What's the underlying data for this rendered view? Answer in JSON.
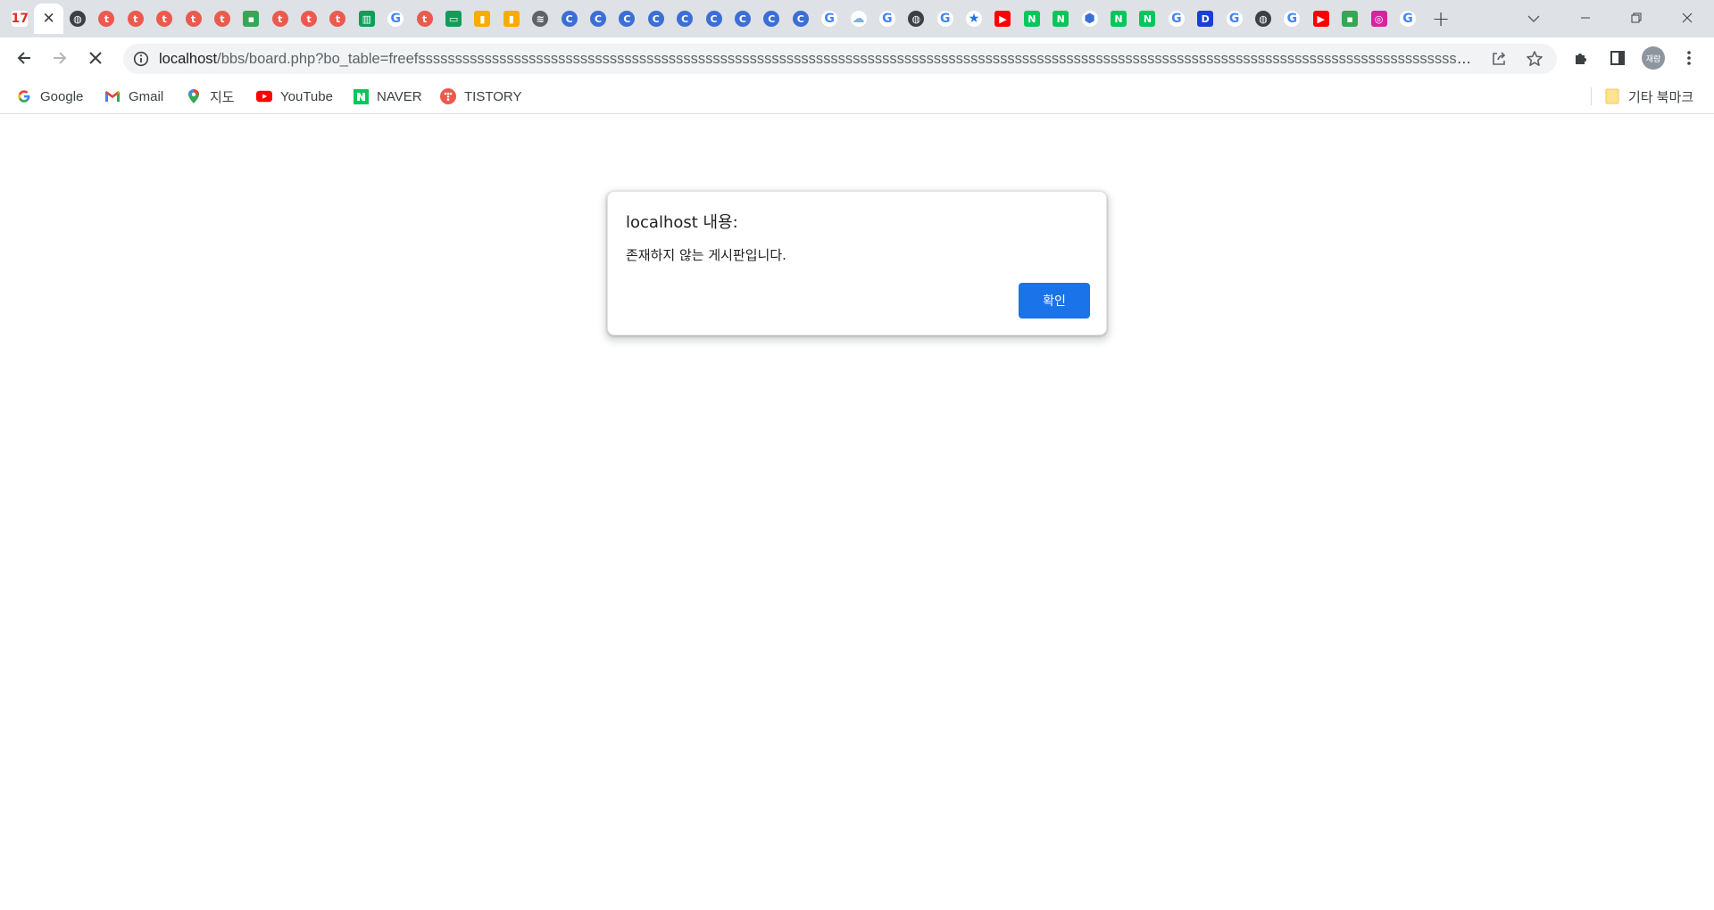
{
  "tabs": [
    {
      "icon": "calendar-icon",
      "glyph": "17",
      "color": "#d93025",
      "shape": "sq",
      "text_color": "#d93025",
      "bg": "#ffffff"
    },
    {
      "icon": "close-icon",
      "glyph": "✕",
      "active": true
    },
    {
      "icon": "globe-icon",
      "glyph": "◍",
      "color": "#3c4043"
    },
    {
      "icon": "tistory-icon",
      "glyph": "t",
      "color": "#eb5a4c"
    },
    {
      "icon": "tistory-icon",
      "glyph": "t",
      "color": "#eb5a4c"
    },
    {
      "icon": "tistory-icon",
      "glyph": "t",
      "color": "#eb5a4c"
    },
    {
      "icon": "tistory-icon",
      "glyph": "t",
      "color": "#eb5a4c"
    },
    {
      "icon": "tistory-icon",
      "glyph": "t",
      "color": "#eb5a4c"
    },
    {
      "icon": "pin-icon",
      "glyph": "▪",
      "color": "#34a853",
      "shape": "sq"
    },
    {
      "icon": "tistory-icon",
      "glyph": "t",
      "color": "#eb5a4c"
    },
    {
      "icon": "tistory-icon",
      "glyph": "t",
      "color": "#eb5a4c"
    },
    {
      "icon": "tistory-icon",
      "glyph": "t",
      "color": "#eb5a4c"
    },
    {
      "icon": "sheets-chart-icon",
      "glyph": "▥",
      "color": "#0f9d58",
      "shape": "sq"
    },
    {
      "icon": "google-icon",
      "glyph": "G",
      "color": "#4285f4",
      "text_color": "#4285f4",
      "bg": "#ffffff"
    },
    {
      "icon": "tistory-icon",
      "glyph": "t",
      "color": "#eb5a4c"
    },
    {
      "icon": "slides-icon",
      "glyph": "▭",
      "color": "#0f9d58",
      "shape": "sq"
    },
    {
      "icon": "analytics-icon",
      "glyph": "▮",
      "color": "#f9ab00",
      "shape": "sq"
    },
    {
      "icon": "analytics-icon",
      "glyph": "▮",
      "color": "#f9ab00",
      "shape": "sq"
    },
    {
      "icon": "wifi-icon",
      "glyph": "≋",
      "color": "#5f6368"
    },
    {
      "icon": "c-site-icon",
      "glyph": "C",
      "color": "#3b6fd6"
    },
    {
      "icon": "c-site-icon",
      "glyph": "C",
      "color": "#3b6fd6"
    },
    {
      "icon": "c-site-icon",
      "glyph": "C",
      "color": "#3b6fd6"
    },
    {
      "icon": "c-site-icon",
      "glyph": "C",
      "color": "#3b6fd6"
    },
    {
      "icon": "c-site-icon",
      "glyph": "C",
      "color": "#3b6fd6"
    },
    {
      "icon": "c-site-icon",
      "glyph": "C",
      "color": "#3b6fd6"
    },
    {
      "icon": "c-site-icon",
      "glyph": "C",
      "color": "#3b6fd6"
    },
    {
      "icon": "c-site-icon",
      "glyph": "C",
      "color": "#3b6fd6"
    },
    {
      "icon": "c-site-icon",
      "glyph": "C",
      "color": "#3b6fd6"
    },
    {
      "icon": "google-icon",
      "glyph": "G",
      "color": "#4285f4",
      "text_color": "#4285f4",
      "bg": "#ffffff"
    },
    {
      "icon": "cloud-icon",
      "glyph": "☁",
      "color": "#9fc3e7",
      "text_color": "#7fb0e0",
      "bg": "#ffffff"
    },
    {
      "icon": "google-icon",
      "glyph": "G",
      "color": "#4285f4",
      "text_color": "#4285f4",
      "bg": "#ffffff"
    },
    {
      "icon": "globe-icon",
      "glyph": "◍",
      "color": "#3c4043"
    },
    {
      "icon": "google-icon",
      "glyph": "G",
      "color": "#4285f4",
      "text_color": "#4285f4",
      "bg": "#ffffff"
    },
    {
      "icon": "star-icon",
      "glyph": "★",
      "color": "#1a73e8",
      "text_color": "#1a73e8",
      "bg": "#ffffff"
    },
    {
      "icon": "youtube-icon",
      "glyph": "▶",
      "color": "#ff0000",
      "shape": "sq"
    },
    {
      "icon": "naver-icon",
      "glyph": "N",
      "color": "#03c75a",
      "shape": "sq"
    },
    {
      "icon": "naver-icon",
      "glyph": "N",
      "color": "#03c75a",
      "shape": "sq"
    },
    {
      "icon": "hexagon-icon",
      "glyph": "⬢",
      "color": "#3a6fd8",
      "text_color": "#3a6fd8",
      "bg": "#ffffff"
    },
    {
      "icon": "naver-icon",
      "glyph": "N",
      "color": "#03c75a",
      "shape": "sq"
    },
    {
      "icon": "naver-icon",
      "glyph": "N",
      "color": "#03c75a",
      "shape": "sq"
    },
    {
      "icon": "google-icon",
      "glyph": "G",
      "color": "#4285f4",
      "text_color": "#4285f4",
      "bg": "#ffffff"
    },
    {
      "icon": "d-site-icon",
      "glyph": "D",
      "color": "#1a3fd8",
      "shape": "sq"
    },
    {
      "icon": "google-icon",
      "glyph": "G",
      "color": "#4285f4",
      "text_color": "#4285f4",
      "bg": "#ffffff"
    },
    {
      "icon": "globe-icon",
      "glyph": "◍",
      "color": "#3c4043"
    },
    {
      "icon": "google-icon",
      "glyph": "G",
      "color": "#4285f4",
      "text_color": "#4285f4",
      "bg": "#ffffff"
    },
    {
      "icon": "youtube-icon",
      "glyph": "▶",
      "color": "#ff0000",
      "shape": "sq"
    },
    {
      "icon": "pin-icon",
      "glyph": "▪",
      "color": "#34a853",
      "shape": "sq"
    },
    {
      "icon": "instagram-icon",
      "glyph": "◎",
      "color": "#d6249f",
      "shape": "sq"
    },
    {
      "icon": "google-icon",
      "glyph": "G",
      "color": "#4285f4",
      "text_color": "#4285f4",
      "bg": "#ffffff"
    }
  ],
  "omnibox": {
    "host": "localhost",
    "path": "/bbs/board.php?bo_table=freefsssssssssssssssssssssssssssssssssssssssssssssssssssssssssssssssssssssssssssssssssssssssssssssssssssssssssssssssssssssssssssssssssssssssssssssssssssssssssssssssssssssssssssssssssssssssssss..."
  },
  "profile": {
    "initials": "재람"
  },
  "bookmarks": [
    {
      "label": "Google",
      "icon": "google-icon"
    },
    {
      "label": "Gmail",
      "icon": "gmail-icon"
    },
    {
      "label": "지도",
      "icon": "maps-icon"
    },
    {
      "label": "YouTube",
      "icon": "youtube-icon"
    },
    {
      "label": "NAVER",
      "icon": "naver-icon"
    },
    {
      "label": "TISTORY",
      "icon": "tistory-icon"
    }
  ],
  "other_bookmarks": {
    "label": "기타 북마크",
    "icon": "folder-icon"
  },
  "dialog": {
    "title": "localhost 내용:",
    "message": "존재하지 않는 게시판입니다.",
    "ok_label": "확인"
  },
  "colors": {
    "accent": "#1a73e8",
    "tabstrip": "#dee1e6"
  }
}
